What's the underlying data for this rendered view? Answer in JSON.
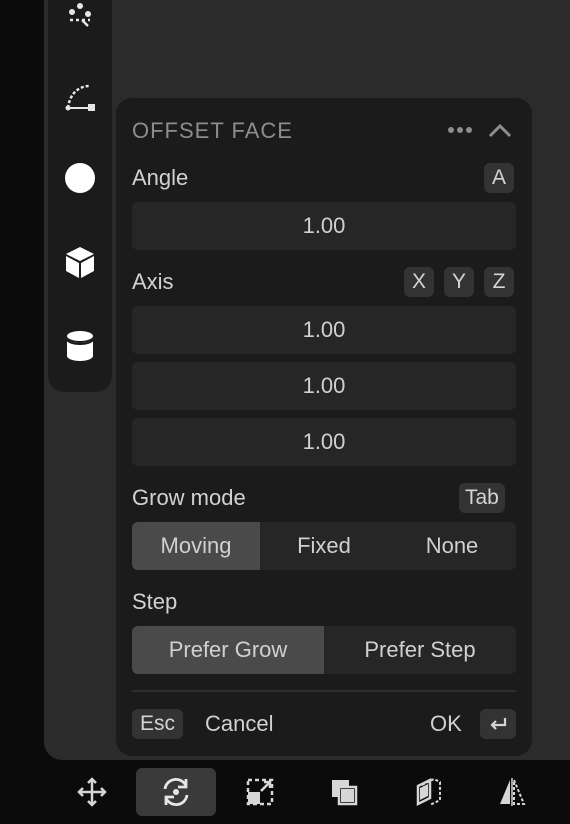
{
  "panel": {
    "title": "OFFSET FACE",
    "angle": {
      "label": "Angle",
      "shortcut": "A",
      "value": "1.00"
    },
    "axis": {
      "label": "Axis",
      "shortcuts": [
        "X",
        "Y",
        "Z"
      ],
      "values": [
        "1.00",
        "1.00",
        "1.00"
      ]
    },
    "grow_mode": {
      "label": "Grow mode",
      "shortcut": "Tab",
      "options": [
        "Moving",
        "Fixed",
        "None"
      ],
      "selected": "Moving"
    },
    "step": {
      "label": "Step",
      "options": [
        "Prefer Grow",
        "Prefer Step"
      ],
      "selected": "Prefer Grow"
    },
    "footer": {
      "cancel_key": "Esc",
      "cancel_label": "Cancel",
      "ok_label": "OK"
    }
  },
  "left_toolbar": {
    "icons": [
      "scatter-icon",
      "curve-icon",
      "sphere-icon",
      "cube-icon",
      "cylinder-icon"
    ]
  },
  "bottom_toolbar": {
    "icons": [
      "move-icon",
      "rotate-icon",
      "scale-icon",
      "boolean-icon",
      "offset-face-icon",
      "mirror-icon"
    ],
    "active": "rotate-icon"
  },
  "colors": {
    "background": "#0b0b0b",
    "viewport": "#2b2b2b",
    "panel": "#1b1b1b",
    "field": "#262626",
    "active_segment": "#4a4a4a"
  }
}
